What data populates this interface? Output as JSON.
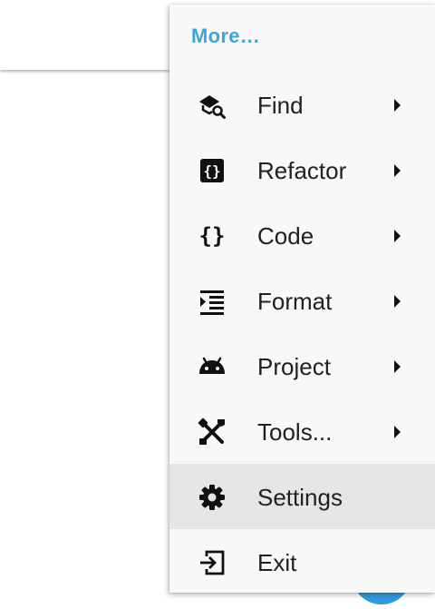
{
  "menu": {
    "header": "More…",
    "items": [
      {
        "label": "Find",
        "icon": "find-icon",
        "has_submenu": true,
        "highlighted": false
      },
      {
        "label": "Refactor",
        "icon": "refactor-icon",
        "has_submenu": true,
        "highlighted": false
      },
      {
        "label": "Code",
        "icon": "code-braces-icon",
        "has_submenu": true,
        "highlighted": false
      },
      {
        "label": "Format",
        "icon": "format-indent-icon",
        "has_submenu": true,
        "highlighted": false
      },
      {
        "label": "Project",
        "icon": "android-icon",
        "has_submenu": true,
        "highlighted": false
      },
      {
        "label": "Tools...",
        "icon": "tools-icon",
        "has_submenu": true,
        "highlighted": false
      },
      {
        "label": "Settings",
        "icon": "gear-icon",
        "has_submenu": false,
        "highlighted": true
      },
      {
        "label": "Exit",
        "icon": "exit-icon",
        "has_submenu": false,
        "highlighted": false
      }
    ]
  },
  "colors": {
    "accent": "#3aa6dd",
    "fab": "#2f9be0",
    "menu_background": "#f8f8f8",
    "highlight": "#e6e6e6",
    "text": "#212121"
  }
}
